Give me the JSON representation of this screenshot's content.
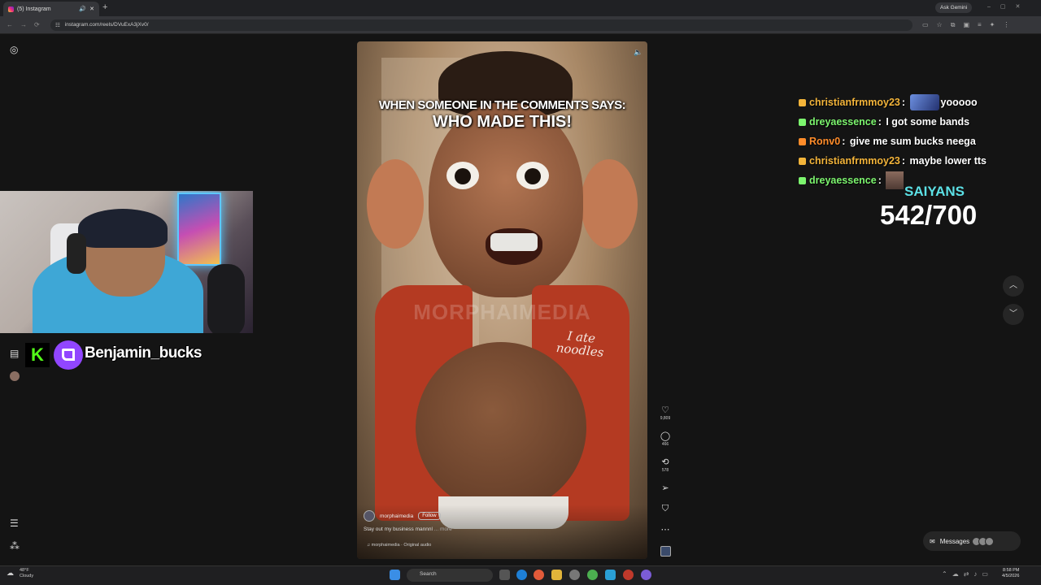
{
  "browser": {
    "tab_title": "(5) Instagram",
    "url": "instagram.com/reels/DVuExA3jXv0/",
    "gemini_label": "Ask Gemini"
  },
  "reel": {
    "caption_line1": "WHEN SOMEONE IN THE COMMENTS SAYS:",
    "caption_line2": "WHO MADE THIS!",
    "watermark": "MORPHAIMEDIA",
    "shirt_text": "I ate noodles",
    "author": "morphaimedia",
    "follow_label": "Follow",
    "description": "Stay out my business mannnl",
    "more_label": "... more",
    "audio": "♫ morphaimedia · Original audio",
    "likes": "9,809",
    "comments": "466",
    "reposts": "578"
  },
  "overlay": {
    "streamer_name": "Benjamin_bucks",
    "goal_label": "SAIYANS",
    "goal_value": "542/700"
  },
  "chat": [
    {
      "user": "christianfrmmoy23",
      "color": "#f3b43a",
      "text": "yooooo",
      "emote": true
    },
    {
      "user": "dreyaessence",
      "color": "#7cf56e",
      "text": "I got some bands"
    },
    {
      "user": "Ronv0",
      "color": "#ff8c2a",
      "text": "give me sum bucks neega"
    },
    {
      "user": "christianfrmmoy23",
      "color": "#f3b43a",
      "text": "maybe lower tts"
    },
    {
      "user": "dreyaessence",
      "color": "#7cf56e",
      "text": "",
      "emote2": true
    }
  ],
  "messages_label": "Messages",
  "taskbar": {
    "weather_temp": "48°F",
    "weather_desc": "Cloudy",
    "search_placeholder": "Search",
    "time": "8:58 PM",
    "date": "4/5/2026"
  }
}
